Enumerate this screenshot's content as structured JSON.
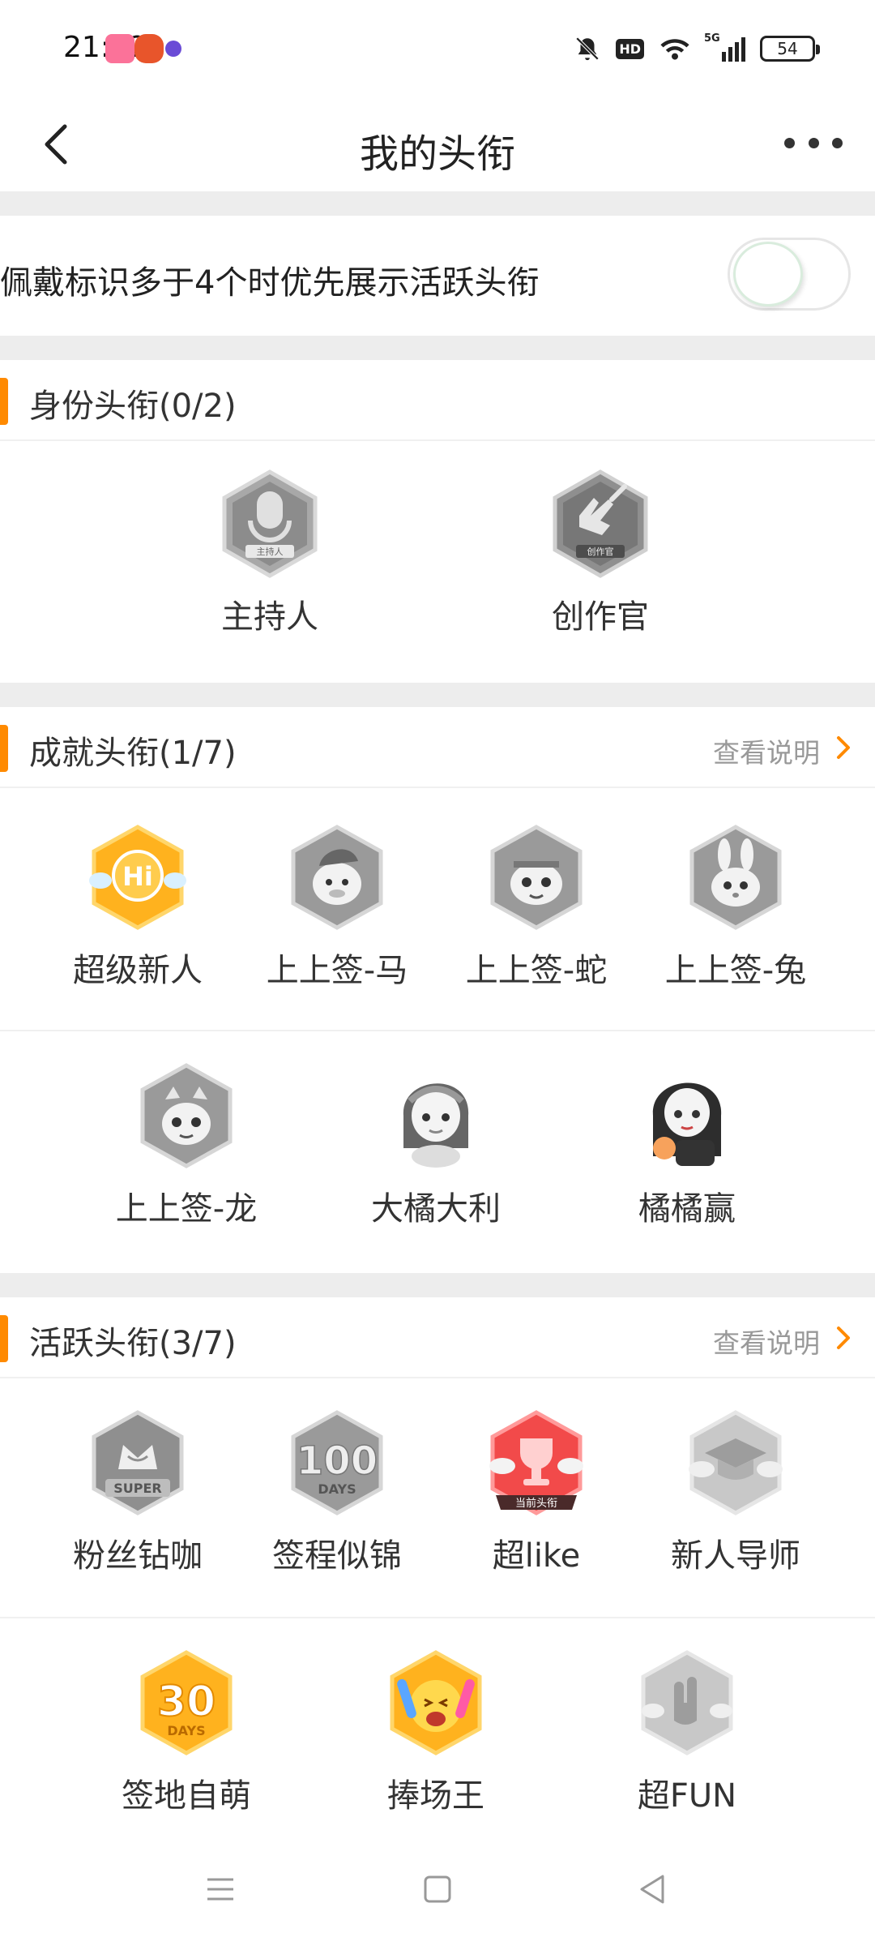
{
  "status_bar": {
    "time": "21:12",
    "network": "5G",
    "battery": "54",
    "hd": "HD"
  },
  "nav": {
    "title": "我的头衔"
  },
  "setting": {
    "label": "佩戴标识多于4个时优先展示活跃头衔",
    "toggle_on": false
  },
  "identity": {
    "title": "身份头衔(0/2)",
    "badges": [
      {
        "label": "主持人",
        "icon": "microphone-badge-icon",
        "sub": "主持人"
      },
      {
        "label": "创作官",
        "icon": "pen-hand-badge-icon",
        "sub": "创作官"
      }
    ]
  },
  "achievement": {
    "title": "成就头衔(1/7)",
    "link": "查看说明",
    "badges": [
      {
        "label": "超级新人",
        "icon": "hi-badge-icon",
        "badge_text": "Hi"
      },
      {
        "label": "上上签-马",
        "icon": "horse-badge-icon"
      },
      {
        "label": "上上签-蛇",
        "icon": "snake-badge-icon"
      },
      {
        "label": "上上签-兔",
        "icon": "rabbit-badge-icon"
      },
      {
        "label": "上上签-龙",
        "icon": "dragon-badge-icon"
      },
      {
        "label": "大橘大利",
        "icon": "girl-portrait-icon"
      },
      {
        "label": "橘橘赢",
        "icon": "girl-orange-portrait-icon"
      }
    ]
  },
  "active": {
    "title": "活跃头衔(3/7)",
    "link": "查看说明",
    "badges": [
      {
        "label": "粉丝钻咖",
        "icon": "crown-super-badge-icon",
        "badge_text": "SUPER"
      },
      {
        "label": "签程似锦",
        "icon": "100-days-badge-icon",
        "badge_text": "100",
        "badge_sub": "DAYS"
      },
      {
        "label": "超like",
        "icon": "trophy-badge-icon",
        "tag": "当前头衔"
      },
      {
        "label": "新人导师",
        "icon": "mortarboard-badge-icon"
      },
      {
        "label": "签地自萌",
        "icon": "30-days-badge-icon",
        "badge_text": "30",
        "badge_sub": "DAYS"
      },
      {
        "label": "捧场王",
        "icon": "cheering-face-badge-icon"
      },
      {
        "label": "超FUN",
        "icon": "rock-hand-badge-icon"
      }
    ]
  },
  "colors": {
    "accent": "#ff8a00",
    "divider": "#ededed",
    "gray_badge": "#9a9a9a",
    "gold_badge": "#ffb21e",
    "red_badge": "#f24a4a"
  }
}
